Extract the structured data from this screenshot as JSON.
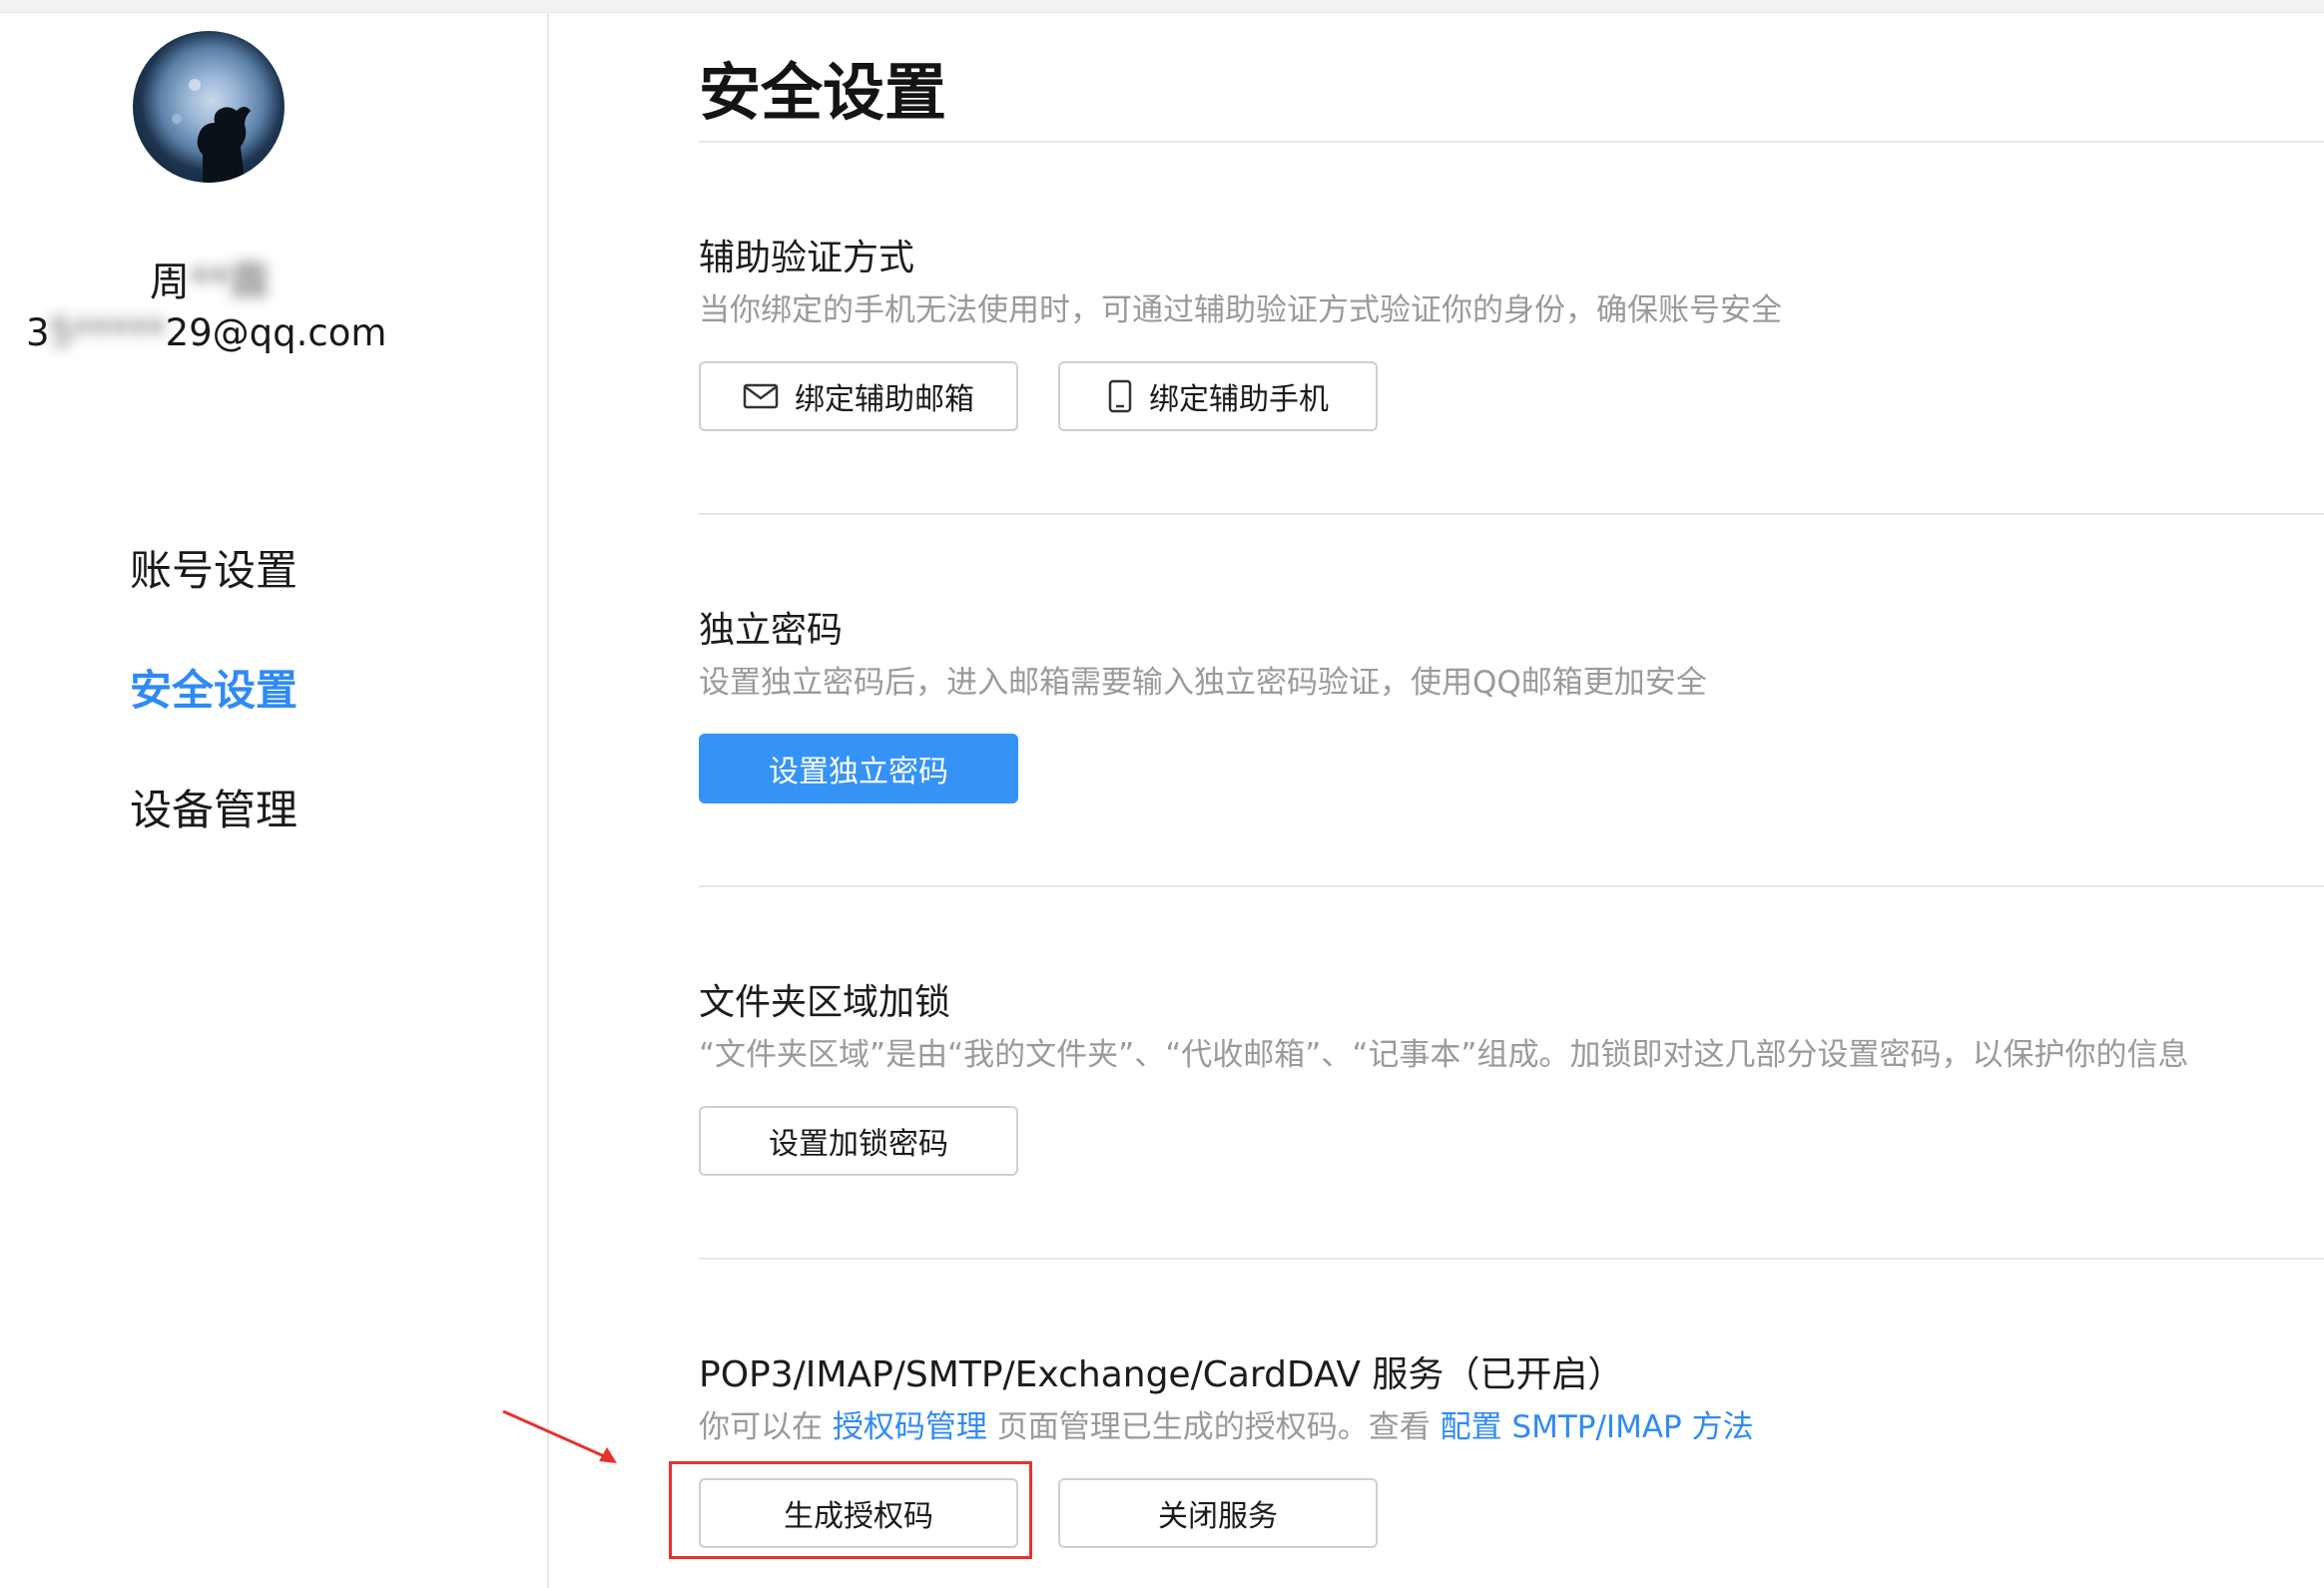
{
  "sidebar": {
    "user": {
      "name_visible": "周",
      "name_blurred": "**霖",
      "email_prefix_visible": "3",
      "email_blurred": "5*****",
      "email_suffix": "29@qq.com"
    },
    "nav": [
      {
        "label": "账号设置",
        "active": false
      },
      {
        "label": "安全设置",
        "active": true
      },
      {
        "label": "设备管理",
        "active": false
      }
    ]
  },
  "main": {
    "title": "安全设置",
    "sections": [
      {
        "title": "辅助验证方式",
        "description": "当你绑定的手机无法使用时，可通过辅助验证方式验证你的身份，确保账号安全",
        "buttons": [
          {
            "label": "绑定辅助邮箱",
            "icon": "mail-icon"
          },
          {
            "label": "绑定辅助手机",
            "icon": "phone-icon"
          }
        ]
      },
      {
        "title": "独立密码",
        "description": "设置独立密码后，进入邮箱需要输入独立密码验证，使用QQ邮箱更加安全",
        "buttons": [
          {
            "label": "设置独立密码",
            "style": "primary"
          }
        ]
      },
      {
        "title": "文件夹区域加锁",
        "description": "“文件夹区域”是由“我的文件夹”、“代收邮箱”、“记事本”组成。加锁即对这几部分设置密码，以保护你的信息",
        "buttons": [
          {
            "label": "设置加锁密码"
          }
        ]
      },
      {
        "title": "POP3/IMAP/SMTP/Exchange/CardDAV 服务（已开启）",
        "description_parts": {
          "pre": "你可以在 ",
          "link1": "授权码管理",
          "mid": " 页面管理已生成的授权码。查看 ",
          "link2": "配置 SMTP/IMAP 方法"
        },
        "buttons": [
          {
            "label": "生成授权码"
          },
          {
            "label": "关闭服务"
          }
        ]
      }
    ]
  },
  "annotation": {
    "color": "#e8312d"
  },
  "colors": {
    "accent": "#2f8af5",
    "primary_button": "#3592f7",
    "muted_text": "#9a9a9a",
    "divider": "#e6e6e6"
  }
}
